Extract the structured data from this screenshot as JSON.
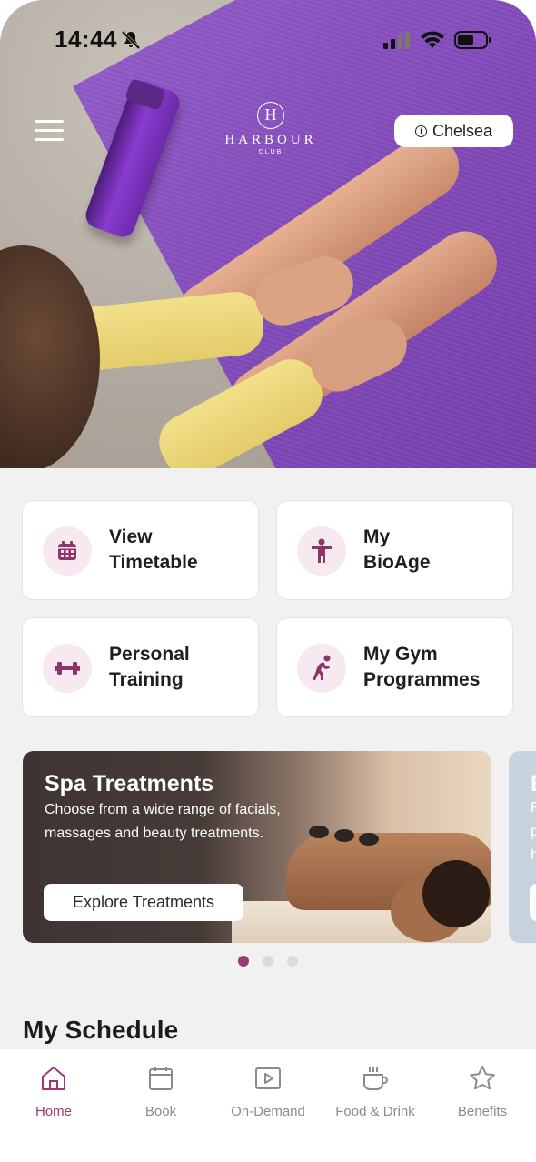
{
  "status_bar": {
    "time": "14:44"
  },
  "header": {
    "logo_mark": "H",
    "logo_text": "HARBOUR",
    "logo_sub": "CLUB",
    "location": "Chelsea"
  },
  "tiles": [
    {
      "line1": "View",
      "line2": "Timetable",
      "icon": "calendar-icon"
    },
    {
      "line1": "My",
      "line2": "BioAge",
      "icon": "person-icon"
    },
    {
      "line1": "Personal",
      "line2": "Training",
      "icon": "dumbbell-icon"
    },
    {
      "line1": "My Gym",
      "line2": "Programmes",
      "icon": "stretch-icon"
    }
  ],
  "promo": {
    "title": "Spa Treatments",
    "description": "Choose from a wide range of facials, massages and beauty treatments.",
    "button": "Explore Treatments",
    "next_title_fragment": "E",
    "next_lines": [
      "F",
      "p",
      "h"
    ]
  },
  "carousel": {
    "total": 3,
    "active": 0
  },
  "schedule": {
    "title": "My Schedule"
  },
  "tabbar": [
    {
      "label": "Home",
      "icon": "home-icon",
      "active": true
    },
    {
      "label": "Book",
      "icon": "calendar-icon",
      "active": false
    },
    {
      "label": "On-Demand",
      "icon": "play-icon",
      "active": false
    },
    {
      "label": "Food & Drink",
      "icon": "coffee-cup-icon",
      "active": false
    },
    {
      "label": "Benefits",
      "icon": "star-icon",
      "active": false
    }
  ],
  "colors": {
    "accent": "#9a3a72",
    "tile_icon_bg": "#f6e9ef",
    "inactive": "#8b8b8b"
  }
}
